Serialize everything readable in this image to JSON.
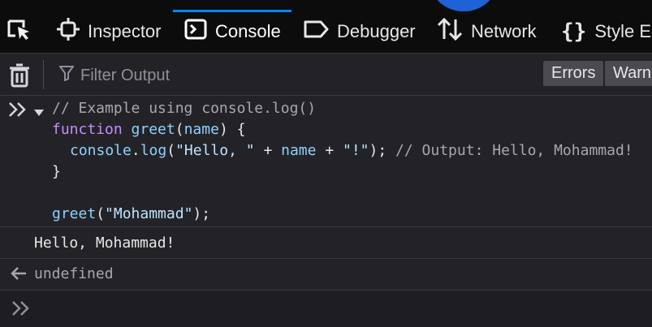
{
  "tabs": [
    {
      "label": "Inspector",
      "icon": "inspector-icon"
    },
    {
      "label": "Console",
      "icon": "console-icon"
    },
    {
      "label": "Debugger",
      "icon": "debugger-icon"
    },
    {
      "label": "Network",
      "icon": "network-icon"
    },
    {
      "label": "Style Ed",
      "icon": "style-editor-icon"
    }
  ],
  "toolbar": {
    "filter_placeholder": "Filter Output",
    "errors_label": "Errors",
    "warnings_label": "Warn"
  },
  "console": {
    "input_lines": [
      "// Example using console.log()",
      "function greet(name) {",
      "  console.log(\"Hello, \" + name + \"!\"); // Output: Hello, Mohammad!",
      "}",
      "",
      "greet(\"Mohammad\");"
    ],
    "output_text": "Hello, Mohammad!",
    "return_value": "undefined"
  },
  "colors": {
    "accent": "#0a84ff",
    "background": "#232327",
    "tabbar_background": "#0c0c0d",
    "keyword": "#c58cff",
    "function": "#8fd0ff",
    "string": "#bfe3ff",
    "comment": "#a7a7ad"
  }
}
